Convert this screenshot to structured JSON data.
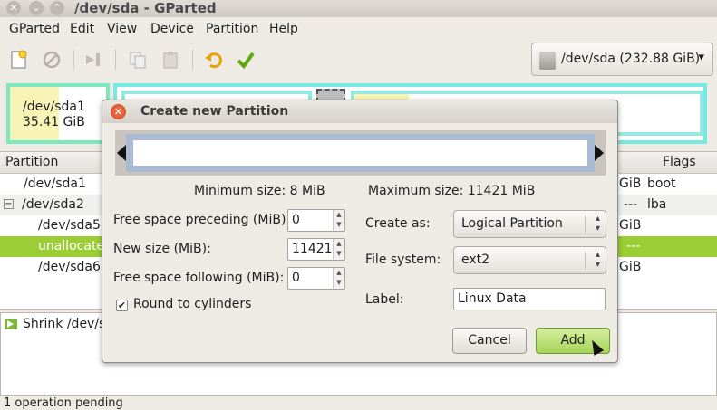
{
  "window": {
    "title": "/dev/sda - GParted"
  },
  "menu": {
    "items": [
      "GParted",
      "Edit",
      "View",
      "Device",
      "Partition",
      "Help"
    ]
  },
  "toolbar": {
    "icons": [
      "new-icon",
      "delete-icon",
      "resize-move-icon",
      "copy-icon",
      "paste-icon",
      "undo-icon",
      "apply-icon"
    ]
  },
  "device_selector": {
    "value": "/dev/sda  (232.88 GiB)"
  },
  "graph": {
    "sda1_name": "/dev/sda1",
    "sda1_size": "35.41 GiB"
  },
  "table": {
    "headers": {
      "partition": "Partition",
      "flags": "Flags"
    },
    "rows": [
      {
        "name": "/dev/sda1",
        "size_tail": "GiB",
        "flags": "boot"
      },
      {
        "name": "/dev/sda2",
        "size_tail": "---",
        "flags": "lba"
      },
      {
        "name": "/dev/sda5",
        "size_tail": "GiB",
        "flags": ""
      },
      {
        "name": "unallocated",
        "size_tail": "---",
        "flags": ""
      },
      {
        "name": "/dev/sda6",
        "size_tail": "GiB",
        "flags": ""
      }
    ]
  },
  "log": {
    "entry": "Shrink /dev/s"
  },
  "status": {
    "text": "1 operation pending"
  },
  "dialog": {
    "title": "Create new Partition",
    "min_size": "Minimum size: 8 MiB",
    "max_size": "Maximum size: 11421 MiB",
    "free_before_label": "Free space preceding (MiB):",
    "free_before_value": "0",
    "new_size_label": "New size (MiB):",
    "new_size_value": "11421",
    "free_after_label": "Free space following (MiB):",
    "free_after_value": "0",
    "round_label": "Round to cylinders",
    "round_checked": true,
    "create_as_label": "Create as:",
    "create_as_value": "Logical Partition",
    "fs_label": "File system:",
    "fs_value": "ext2",
    "label_label": "Label:",
    "label_value": "Linux Data",
    "cancel": "Cancel",
    "add": "Add"
  }
}
